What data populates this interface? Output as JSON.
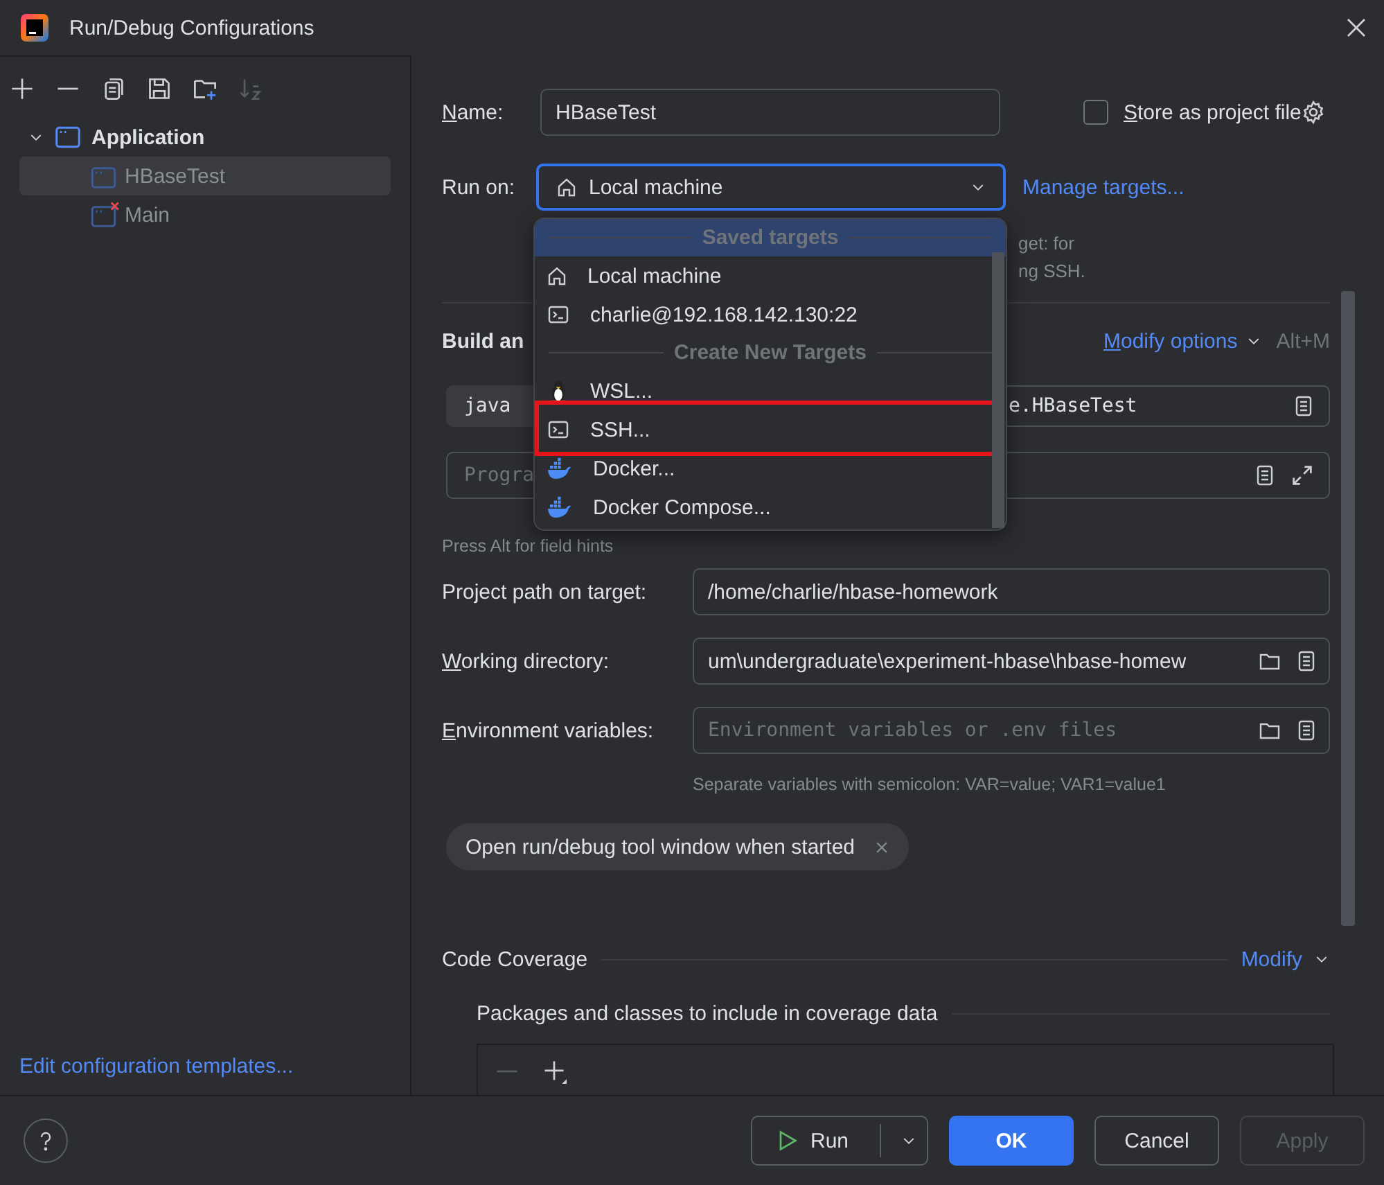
{
  "window": {
    "title": "Run/Debug Configurations"
  },
  "tree": [
    {
      "label": "Application",
      "expanded": true,
      "children": [
        {
          "label": "HBaseTest",
          "selected": true,
          "error": false
        },
        {
          "label": "Main",
          "selected": false,
          "error": true
        }
      ]
    }
  ],
  "templates_link": "Edit configuration templates...",
  "name_field": {
    "label": "Name:",
    "underline_first": true,
    "value": "HBaseTest"
  },
  "store_option": {
    "label": "Store as project file",
    "underline_first": true,
    "checked": false
  },
  "run_on": {
    "label": "Run on:",
    "value": "Local machine",
    "focused": true
  },
  "manage_link": "Manage targets...",
  "run_on_hint": [
    "get: for",
    "ng SSH."
  ],
  "build_section": {
    "title": "Build an",
    "modify_link": "Modify options",
    "underline_first": true,
    "shortcut": "Alt+M"
  },
  "java_field": {
    "left": "java",
    "right": "e.HBaseTest"
  },
  "args_field": {
    "placeholder": "Progra"
  },
  "field_hint": "Press Alt for field hints",
  "fields": [
    {
      "label": "Project path on target:",
      "underline_first": false,
      "kind": "text",
      "value": "/home/charlie/hbase-homework"
    },
    {
      "label": "Working directory:",
      "underline_first": true,
      "kind": "browse",
      "value": "um\\undergraduate\\experiment-hbase\\hbase-homew"
    },
    {
      "label": "Environment variables:",
      "underline_first": true,
      "kind": "browse",
      "placeholder": "Environment variables or .env files"
    }
  ],
  "env_hint": "Separate variables with semicolon: VAR=value; VAR1=value1",
  "chips": [
    {
      "label": "Open run/debug tool window when started"
    }
  ],
  "coverage": {
    "title": "Code Coverage",
    "modify_link": "Modify",
    "subtitle": "Packages and classes to include in coverage data"
  },
  "targets_popup": {
    "items": [
      {
        "kind": "header",
        "label": "Saved targets",
        "selected": true,
        "annotated": false
      },
      {
        "kind": "local",
        "label": "Local machine",
        "selected": false,
        "annotated": false
      },
      {
        "kind": "ssh",
        "label": "charlie@192.168.142.130:22",
        "selected": false,
        "annotated": false
      },
      {
        "kind": "header",
        "label": "Create New Targets",
        "selected": false,
        "annotated": false
      },
      {
        "kind": "wsl",
        "label": "WSL...",
        "selected": false,
        "annotated": false
      },
      {
        "kind": "ssh",
        "label": "SSH...",
        "selected": false,
        "annotated": true
      },
      {
        "kind": "docker",
        "label": "Docker...",
        "selected": false,
        "annotated": false
      },
      {
        "kind": "docker",
        "label": "Docker Compose...",
        "selected": false,
        "annotated": false
      }
    ]
  },
  "buttons": [
    {
      "kind": "run",
      "label": "Run",
      "disabled": false
    },
    {
      "kind": "primary",
      "label": "OK",
      "disabled": false
    },
    {
      "kind": "default",
      "label": "Cancel",
      "disabled": false
    },
    {
      "kind": "default",
      "label": "Apply",
      "disabled": true
    }
  ]
}
